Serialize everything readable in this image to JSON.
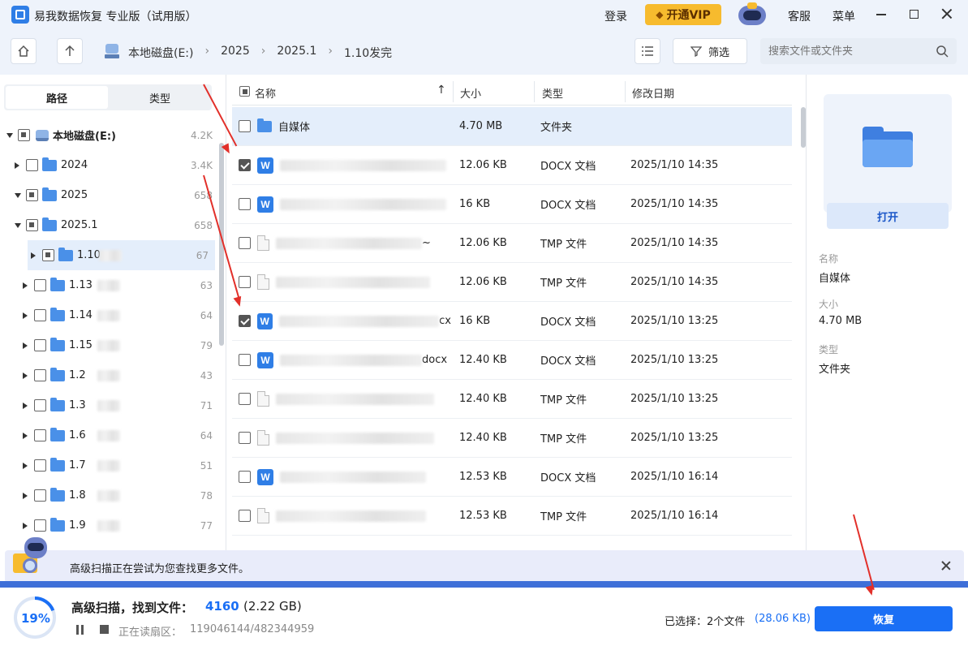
{
  "titlebar": {
    "title": "易我数据恢复 专业版（试用版）",
    "login": "登录",
    "vip": "开通VIP",
    "service": "客服",
    "menu": "菜单"
  },
  "toolbar": {
    "breadcrumb": [
      "本地磁盘(E:)",
      "2025",
      "2025.1",
      "1.10发完"
    ],
    "filter": "筛选",
    "search_placeholder": "搜索文件或文件夹"
  },
  "left_tabs": {
    "path": "路径",
    "type": "类型"
  },
  "tree": [
    {
      "label": "本地磁盘(E:)",
      "count": "4.2K",
      "level": 0,
      "expanded": true,
      "check": "partial"
    },
    {
      "label": "2024",
      "count": "3.4K",
      "level": 1,
      "expanded": false,
      "check": "none"
    },
    {
      "label": "2025",
      "count": "658",
      "level": 1,
      "expanded": true,
      "check": "partial"
    },
    {
      "label": "2025.1",
      "count": "658",
      "level": 2,
      "expanded": true,
      "check": "partial"
    },
    {
      "label": "1.10",
      "count": "67",
      "level": 3,
      "expanded": false,
      "check": "partial",
      "selected": true
    },
    {
      "label": "1.13",
      "count": "63",
      "level": 3,
      "expanded": false,
      "check": "none"
    },
    {
      "label": "1.14",
      "count": "64",
      "level": 3,
      "expanded": false,
      "check": "none"
    },
    {
      "label": "1.15",
      "count": "79",
      "level": 3,
      "expanded": false,
      "check": "none"
    },
    {
      "label": "1.2",
      "count": "43",
      "level": 3,
      "expanded": false,
      "check": "none"
    },
    {
      "label": "1.3",
      "count": "71",
      "level": 3,
      "expanded": false,
      "check": "none"
    },
    {
      "label": "1.6",
      "count": "64",
      "level": 3,
      "expanded": false,
      "check": "none"
    },
    {
      "label": "1.7",
      "count": "51",
      "level": 3,
      "expanded": false,
      "check": "none"
    },
    {
      "label": "1.8",
      "count": "78",
      "level": 3,
      "expanded": false,
      "check": "none"
    },
    {
      "label": "1.9",
      "count": "77",
      "level": 3,
      "expanded": false,
      "check": "none"
    }
  ],
  "columns": {
    "name": "名称",
    "size": "大小",
    "type": "类型",
    "date": "修改日期"
  },
  "files": [
    {
      "name": "自媒体",
      "size": "4.70 MB",
      "type": "文件夹",
      "date": "",
      "icon": "folder",
      "checked": false,
      "highlight": true
    },
    {
      "name": "",
      "size": "12.06 KB",
      "type": "DOCX 文档",
      "date": "2025/1/10 14:35",
      "icon": "word",
      "checked": true
    },
    {
      "name": "",
      "size": "16 KB",
      "type": "DOCX 文档",
      "date": "2025/1/10 14:35",
      "icon": "word",
      "checked": false
    },
    {
      "name": "~",
      "size": "12.06 KB",
      "type": "TMP 文件",
      "date": "2025/1/10 14:35",
      "icon": "file",
      "checked": false
    },
    {
      "name": "",
      "size": "12.06 KB",
      "type": "TMP 文件",
      "date": "2025/1/10 14:35",
      "icon": "file",
      "checked": false
    },
    {
      "name": "cx",
      "size": "16 KB",
      "type": "DOCX 文档",
      "date": "2025/1/10 13:25",
      "icon": "word",
      "checked": true
    },
    {
      "name": "docx",
      "size": "12.40 KB",
      "type": "DOCX 文档",
      "date": "2025/1/10 13:25",
      "icon": "word",
      "checked": false
    },
    {
      "name": "",
      "size": "12.40 KB",
      "type": "TMP 文件",
      "date": "2025/1/10 13:25",
      "icon": "file",
      "checked": false
    },
    {
      "name": "",
      "size": "12.40 KB",
      "type": "TMP 文件",
      "date": "2025/1/10 13:25",
      "icon": "file",
      "checked": false
    },
    {
      "name": "",
      "size": "12.53 KB",
      "type": "DOCX 文档",
      "date": "2025/1/10 16:14",
      "icon": "word",
      "checked": false
    },
    {
      "name": "",
      "size": "12.53 KB",
      "type": "TMP 文件",
      "date": "2025/1/10 16:14",
      "icon": "file",
      "checked": false
    }
  ],
  "preview": {
    "open": "打开",
    "name_label": "名称",
    "name_value": "自媒体",
    "size_label": "大小",
    "size_value": "4.70 MB",
    "type_label": "类型",
    "type_value": "文件夹"
  },
  "notice": "高级扫描正在尝试为您查找更多文件。",
  "footer": {
    "progress": "19%",
    "progress_value": 0.19,
    "scan_label": "高级扫描，找到文件：",
    "found_count": "4160",
    "found_size": "(2.22 GB)",
    "reading_label": "正在读扇区：",
    "reading_value": "119046144/482344959",
    "selected_label": "已选择：2个文件",
    "selected_size": "(28.06 KB)",
    "recover": "恢复"
  },
  "colors": {
    "accent": "#1a6ff5",
    "highlight_row": "#e4eefb",
    "selected_tree": "#e4eefb",
    "arrow": "#e2302a"
  }
}
